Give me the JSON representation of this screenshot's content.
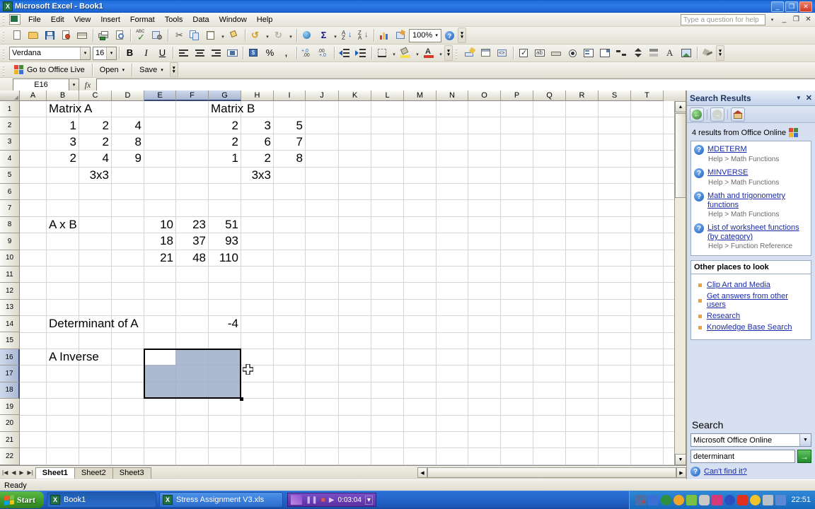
{
  "window": {
    "title": "Microsoft Excel - Book1",
    "app_icon": "excel-icon",
    "minimize": "_",
    "restore": "❐",
    "close": "✕"
  },
  "menu": {
    "items": [
      "File",
      "Edit",
      "View",
      "Insert",
      "Format",
      "Tools",
      "Data",
      "Window",
      "Help"
    ],
    "help_question_placeholder": "Type a question for help",
    "doc_minimize": "_",
    "doc_restore": "❐",
    "doc_close": "✕"
  },
  "standard_toolbar": {
    "buttons": [
      "new-icon",
      "open-icon",
      "save-icon",
      "permission-icon",
      "email-icon",
      "print-icon",
      "print-preview-icon",
      "spelling-icon",
      "research-icon",
      "cut-icon",
      "copy-icon",
      "paste-icon",
      "format-painter-icon",
      "undo-icon",
      "redo-icon",
      "hyperlink-icon",
      "autosum-icon",
      "sort-ascending-icon",
      "sort-descending-icon",
      "chart-wizard-icon",
      "drawing-icon"
    ],
    "zoom_value": "100%",
    "help_icon": "help-icon",
    "overflow": "toolbar-options"
  },
  "formatting_toolbar": {
    "font_name": "Verdana",
    "font_size": "16",
    "bold": "B",
    "italic": "I",
    "underline": "U",
    "align_left": "align-left-icon",
    "align_center": "align-center-icon",
    "align_right": "align-right-icon",
    "merge_center": "merge-center-icon",
    "currency": "currency-icon",
    "percent": "%",
    "comma": ",",
    "increase_decimal": "increase-decimal-icon",
    "decrease_decimal": "decrease-decimal-icon",
    "decrease_indent": "decrease-indent-icon",
    "increase_indent": "increase-indent-icon",
    "borders": "borders-icon",
    "fill_color": "fill-color-icon",
    "font_color": "font-color-icon"
  },
  "controls_toolbar": {
    "buttons": [
      "design-mode-icon",
      "properties-icon",
      "view-code-icon",
      "checkbox-icon",
      "textbox-icon",
      "command-button-icon",
      "option-button-icon",
      "listbox-icon",
      "combobox-icon",
      "toggle-button-icon",
      "spinbutton-icon",
      "scrollbar-icon",
      "label-icon",
      "image-icon",
      "more-controls-icon"
    ]
  },
  "office_live_toolbar": {
    "go_to_office_live": "Go to Office Live",
    "open": "Open",
    "save": "Save"
  },
  "formula_bar": {
    "name_box": "E16",
    "fx_label": "fx",
    "formula_value": ""
  },
  "grid": {
    "columns": [
      "A",
      "B",
      "C",
      "D",
      "E",
      "F",
      "G",
      "H",
      "I",
      "J",
      "K",
      "L",
      "M",
      "N",
      "O",
      "P",
      "Q",
      "R",
      "S",
      "T"
    ],
    "selected_columns": [
      "E",
      "F",
      "G"
    ],
    "rows": [
      1,
      2,
      3,
      4,
      5,
      6,
      7,
      8,
      9,
      10,
      11,
      12,
      13,
      14,
      15,
      16,
      17,
      18,
      19,
      20,
      21,
      22
    ],
    "selected_rows": [
      16,
      17,
      18
    ],
    "cells": [
      {
        "col": "B",
        "row": 1,
        "value": "Matrix A",
        "align": "left"
      },
      {
        "col": "G",
        "row": 1,
        "value": "Matrix B",
        "align": "left"
      },
      {
        "col": "B",
        "row": 2,
        "value": "1",
        "align": "right"
      },
      {
        "col": "C",
        "row": 2,
        "value": "2",
        "align": "right"
      },
      {
        "col": "D",
        "row": 2,
        "value": "4",
        "align": "right"
      },
      {
        "col": "G",
        "row": 2,
        "value": "2",
        "align": "right"
      },
      {
        "col": "H",
        "row": 2,
        "value": "3",
        "align": "right"
      },
      {
        "col": "I",
        "row": 2,
        "value": "5",
        "align": "right"
      },
      {
        "col": "B",
        "row": 3,
        "value": "3",
        "align": "right"
      },
      {
        "col": "C",
        "row": 3,
        "value": "2",
        "align": "right"
      },
      {
        "col": "D",
        "row": 3,
        "value": "8",
        "align": "right"
      },
      {
        "col": "G",
        "row": 3,
        "value": "2",
        "align": "right"
      },
      {
        "col": "H",
        "row": 3,
        "value": "6",
        "align": "right"
      },
      {
        "col": "I",
        "row": 3,
        "value": "7",
        "align": "right"
      },
      {
        "col": "B",
        "row": 4,
        "value": "2",
        "align": "right"
      },
      {
        "col": "C",
        "row": 4,
        "value": "4",
        "align": "right"
      },
      {
        "col": "D",
        "row": 4,
        "value": "9",
        "align": "right"
      },
      {
        "col": "G",
        "row": 4,
        "value": "1",
        "align": "right"
      },
      {
        "col": "H",
        "row": 4,
        "value": "2",
        "align": "right"
      },
      {
        "col": "I",
        "row": 4,
        "value": "8",
        "align": "right"
      },
      {
        "col": "C",
        "row": 5,
        "value": "3x3",
        "align": "right"
      },
      {
        "col": "H",
        "row": 5,
        "value": "3x3",
        "align": "right"
      },
      {
        "col": "B",
        "row": 8,
        "value": "A x B",
        "align": "left"
      },
      {
        "col": "E",
        "row": 8,
        "value": "10",
        "align": "right"
      },
      {
        "col": "F",
        "row": 8,
        "value": "23",
        "align": "right"
      },
      {
        "col": "G",
        "row": 8,
        "value": "51",
        "align": "right"
      },
      {
        "col": "E",
        "row": 9,
        "value": "18",
        "align": "right"
      },
      {
        "col": "F",
        "row": 9,
        "value": "37",
        "align": "right"
      },
      {
        "col": "G",
        "row": 9,
        "value": "93",
        "align": "right"
      },
      {
        "col": "E",
        "row": 10,
        "value": "21",
        "align": "right"
      },
      {
        "col": "F",
        "row": 10,
        "value": "48",
        "align": "right"
      },
      {
        "col": "G",
        "row": 10,
        "value": "110",
        "align": "right"
      },
      {
        "col": "B",
        "row": 14,
        "value": "Determinant of A",
        "align": "left"
      },
      {
        "col": "G",
        "row": 14,
        "value": "-4",
        "align": "right"
      },
      {
        "col": "B",
        "row": 16,
        "value": "A Inverse",
        "align": "left"
      }
    ],
    "selection_range": "E16:G18",
    "active_cell": "E16",
    "mouse_cursor": "cell-cross-cursor"
  },
  "task_pane": {
    "title": "Search Results",
    "dropdown_icon": "chevron-down-icon",
    "close_icon": "close-icon",
    "nav": {
      "back": "back-icon",
      "forward": "forward-icon",
      "home": "home-icon"
    },
    "results_summary": "4 results from Office Online",
    "results_summary_icon": "office-online-icon",
    "results": [
      {
        "title": "MDETERM",
        "path": "Help > Math Functions"
      },
      {
        "title": "MINVERSE",
        "path": "Help > Math Functions"
      },
      {
        "title": "Math and trigonometry functions",
        "path": "Help > Math Functions"
      },
      {
        "title": "List of worksheet functions (by category)",
        "path": "Help > Function Reference"
      }
    ],
    "other_places_header": "Other places to look",
    "other_places": [
      "Clip Art and Media",
      "Get answers from other users",
      "Research",
      "Knowledge Base Search"
    ],
    "search": {
      "heading": "Search",
      "scope_value": "Microsoft Office Online",
      "query_value": "determinant",
      "go_label": "→",
      "cant_find_label": "Can't find it?"
    }
  },
  "sheet_tabs": {
    "tabs": [
      "Sheet1",
      "Sheet2",
      "Sheet3"
    ],
    "active": "Sheet1",
    "nav": {
      "first": "|◀",
      "prev": "◀",
      "next": "▶",
      "last": "▶|"
    }
  },
  "status_bar": {
    "text": "Ready"
  },
  "taskbar": {
    "start_label": "Start",
    "items": [
      {
        "label": "Book1",
        "icon": "excel-icon",
        "active": true
      },
      {
        "label": "Stress Assignment V3.xls",
        "icon": "excel-icon",
        "active": false
      }
    ],
    "recorder": {
      "pause": "❚❚",
      "stop": "■",
      "play": "▶",
      "time": "0:03:04",
      "menu": "▾"
    },
    "clock": "22:51",
    "tray_icons": [
      "network-disconnected-icon",
      "display-icon",
      "antivirus-icon",
      "update-icon",
      "sound-icon",
      "mouse-icon",
      "security-icon",
      "media-icon",
      "ati-icon",
      "messenger-icon",
      "monitor-icon",
      "network-icon"
    ]
  },
  "colors": {
    "title_blue": "#2d7ae6",
    "selection_fill": "#9fadc8",
    "excel_green": "#217346",
    "link_blue": "#1a2ba8",
    "taskpane_bg": "#d6e0f0"
  }
}
